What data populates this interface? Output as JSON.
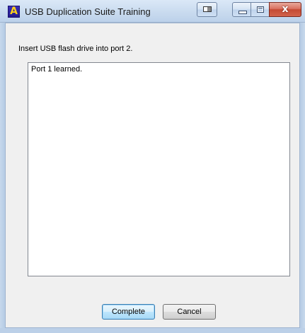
{
  "window": {
    "title": "USB Duplication Suite Training",
    "app_icon_letter": "A"
  },
  "titlebar_buttons": {
    "snap": "snap-icon",
    "minimize": "minimize-icon",
    "maximize": "maximize-icon",
    "close": "close-icon",
    "close_glyph": "x"
  },
  "content": {
    "instruction": "Insert USB flash drive into port 2.",
    "log_text": "Port 1 learned."
  },
  "buttons": {
    "complete_label": "Complete",
    "cancel_label": "Cancel"
  },
  "colors": {
    "titlebar": "#c9dbef",
    "close_button": "#c44a34",
    "dialog_background": "#f0f0f0"
  }
}
